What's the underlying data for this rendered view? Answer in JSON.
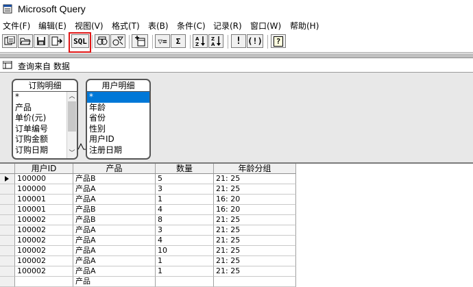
{
  "window": {
    "title": "Microsoft Query"
  },
  "menu": [
    {
      "label": "文件(F)"
    },
    {
      "label": "编辑(E)"
    },
    {
      "label": "视图(V)"
    },
    {
      "label": "格式(T)"
    },
    {
      "label": "表(B)"
    },
    {
      "label": "条件(C)"
    },
    {
      "label": "记录(R)"
    },
    {
      "label": "窗口(W)"
    },
    {
      "label": "帮助(H)"
    }
  ],
  "toolbar": {
    "buttons": [
      {
        "name": "new-query-icon"
      },
      {
        "name": "open-query-icon"
      },
      {
        "name": "save-query-icon"
      },
      {
        "name": "return-data-icon"
      },
      {
        "name": "sql-button",
        "label": "SQL"
      },
      {
        "name": "show-tables-icon"
      },
      {
        "name": "show-criteria-icon"
      },
      {
        "name": "add-tables-icon"
      },
      {
        "name": "criteria-equals-icon",
        "label": "▽="
      },
      {
        "name": "totals-icon",
        "label": "Σ"
      },
      {
        "name": "sort-ascending-icon",
        "label": "A↓Z"
      },
      {
        "name": "sort-descending-icon",
        "label": "Z↓A"
      },
      {
        "name": "query-now-icon",
        "label": "!"
      },
      {
        "name": "auto-query-icon",
        "label": "(!)"
      },
      {
        "name": "help-icon",
        "label": "?"
      }
    ],
    "highlighted": "sql-button",
    "highlight_color": "#e01515"
  },
  "query_window": {
    "title": "查询来自 数据"
  },
  "tables": [
    {
      "name": "订购明细",
      "fields": [
        "*",
        "产品",
        "单价(元)",
        "订单编号",
        "订购金额",
        "订购日期"
      ]
    },
    {
      "name": "用户明细",
      "fields": [
        "*",
        "年龄",
        "省份",
        "性别",
        "用户ID",
        "注册日期"
      ],
      "selected_index": 0
    }
  ],
  "grid": {
    "columns": [
      "用户ID",
      "产品",
      "数量",
      "年龄分组"
    ],
    "rows": [
      [
        "100000",
        "产品B",
        "5",
        "21: 25"
      ],
      [
        "100000",
        "产品A",
        "3",
        "21: 25"
      ],
      [
        "100001",
        "产品A",
        "1",
        "16: 20"
      ],
      [
        "100001",
        "产品B",
        "4",
        "16: 20"
      ],
      [
        "100002",
        "产品B",
        "8",
        "21: 25"
      ],
      [
        "100002",
        "产品A",
        "3",
        "21: 25"
      ],
      [
        "100002",
        "产品A",
        "4",
        "21: 25"
      ],
      [
        "100002",
        "产品A",
        "10",
        "21: 25"
      ],
      [
        "100002",
        "产品A",
        "1",
        "21: 25"
      ],
      [
        "100002",
        "产品A",
        "1",
        "21: 25"
      ],
      [
        "",
        "产品",
        "",
        ""
      ]
    ],
    "current_row": 0
  },
  "colors": {
    "selection": "#0078d7",
    "workspace": "#c0c0c0"
  }
}
